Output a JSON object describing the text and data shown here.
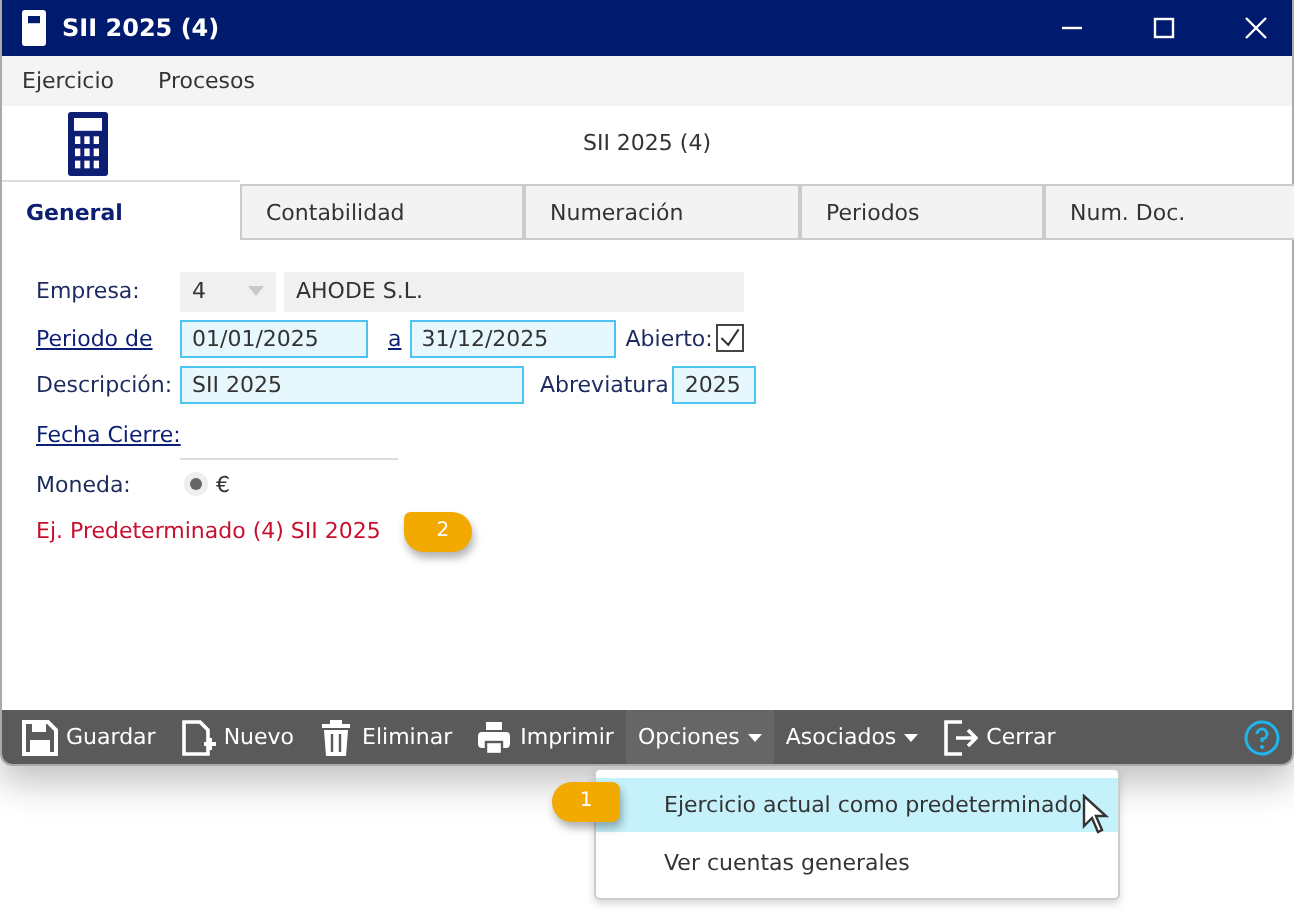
{
  "window": {
    "title": "SII 2025 (4)"
  },
  "menu": [
    "Ejercicio",
    "Procesos"
  ],
  "header": {
    "title": "SII 2025 (4)"
  },
  "tabs": [
    {
      "label": "General",
      "selected": true
    },
    {
      "label": "Contabilidad",
      "selected": false
    },
    {
      "label": "Numeración",
      "selected": false
    },
    {
      "label": "Periodos",
      "selected": false
    },
    {
      "label": "Num. Doc.",
      "selected": false
    }
  ],
  "form": {
    "empresa": {
      "label": "Empresa:",
      "code": "4",
      "name": "AHODE S.L."
    },
    "periodo": {
      "label": "Periodo de",
      "from": "01/01/2025",
      "to_label": "a",
      "to": "31/12/2025",
      "open_label": "Abierto:",
      "open_checked": true
    },
    "descripcion": {
      "label": "Descripción:",
      "value": "SII 2025",
      "abbr_label": "Abreviatura",
      "abbr": "2025"
    },
    "fecha_cierre": {
      "label": "Fecha Cierre:"
    },
    "moneda": {
      "label": "Moneda:",
      "options": [
        {
          "label": "€",
          "selected": true
        }
      ]
    },
    "default_note": {
      "text": "Ej. Predeterminado (4) SII 2025",
      "callout": "2"
    }
  },
  "toolbar": [
    {
      "kind": "save",
      "label": "Guardar"
    },
    {
      "kind": "new",
      "label": "Nuevo"
    },
    {
      "kind": "delete",
      "label": "Eliminar"
    },
    {
      "kind": "print",
      "label": "Imprimir"
    },
    {
      "kind": "menu",
      "label": "Opciones",
      "expanded": true
    },
    {
      "kind": "menu",
      "label": "Asociados",
      "expanded": false
    },
    {
      "kind": "close",
      "label": "Cerrar"
    }
  ],
  "dropdown": {
    "items": [
      {
        "label": "Ejercicio actual como predeterminado",
        "selected": true,
        "callout": "1"
      },
      {
        "label": "Ver cuentas generales",
        "selected": false
      }
    ]
  }
}
